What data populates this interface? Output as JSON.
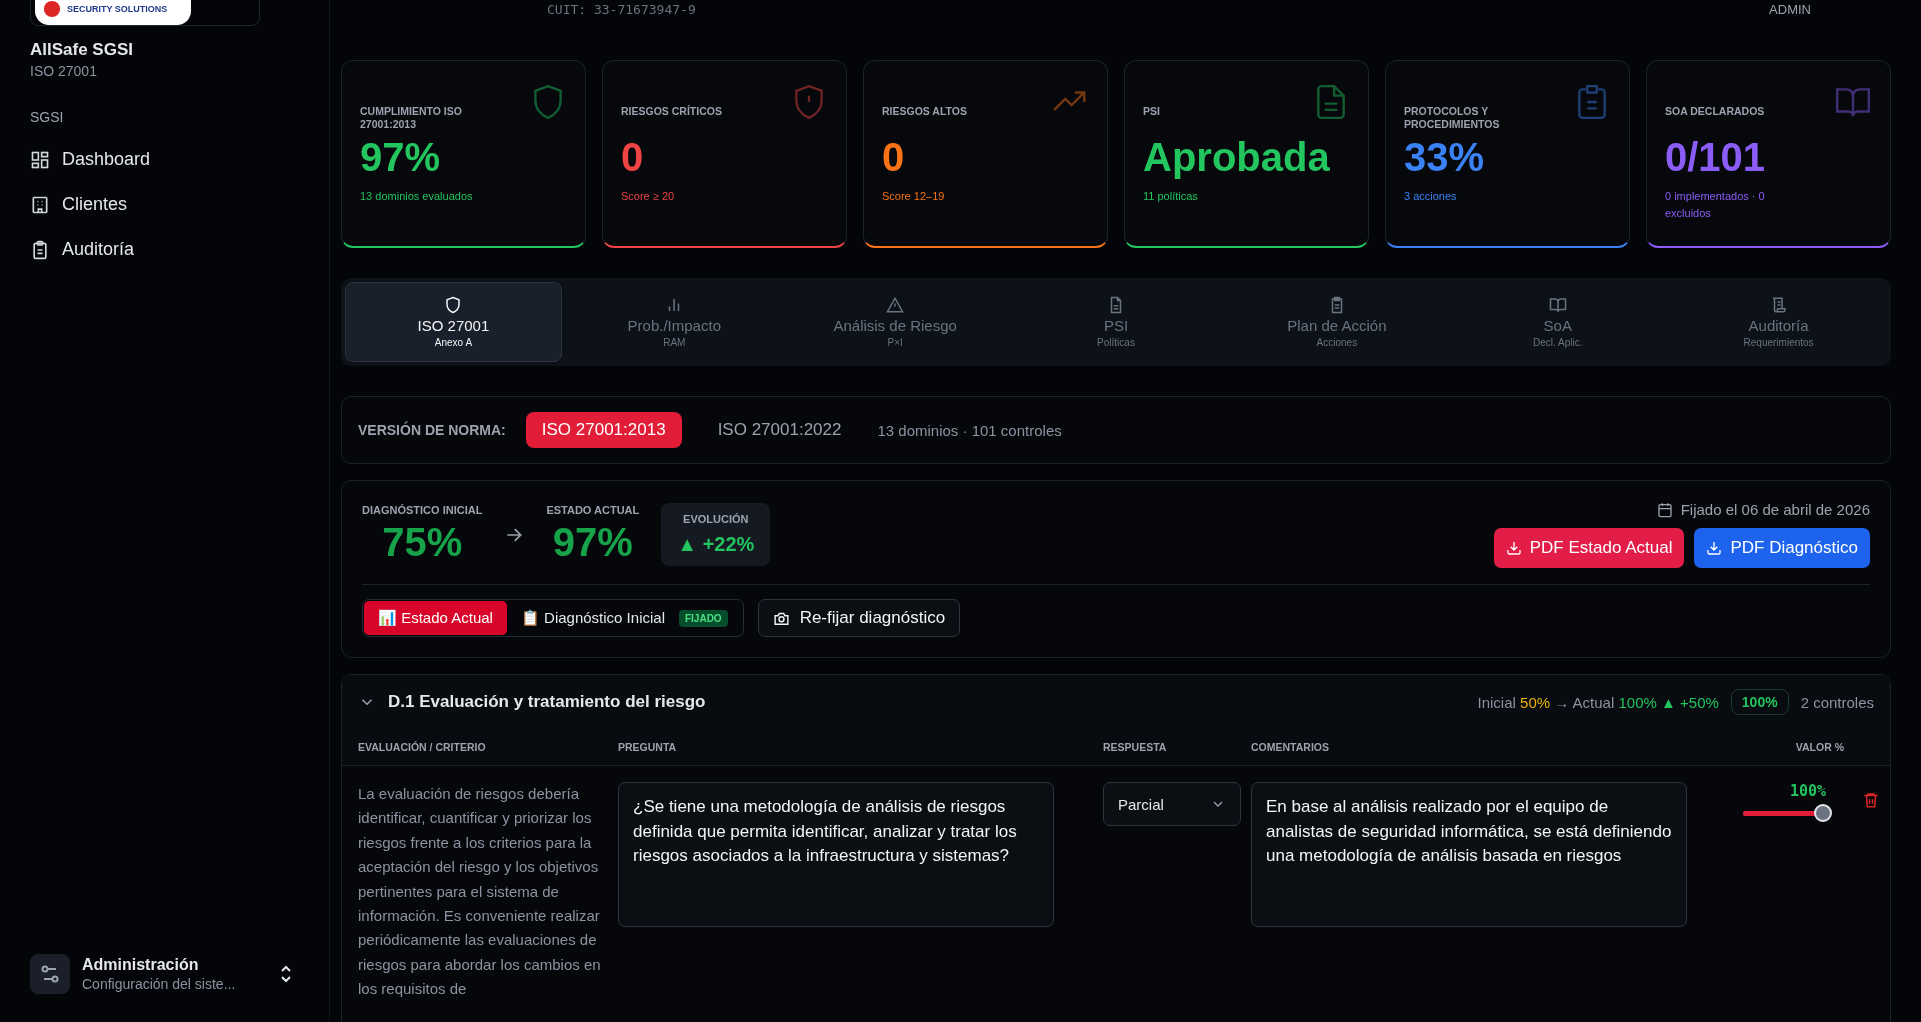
{
  "sidebar": {
    "logo_text": "SECURITY SOLUTIONS",
    "app_name": "AllSafe SGSI",
    "app_subtitle": "ISO 27001",
    "section_label": "SGSI",
    "items": [
      {
        "label": "Dashboard",
        "kind": "grid"
      },
      {
        "label": "Clientes",
        "kind": "building"
      },
      {
        "label": "Auditoría",
        "kind": "clipboard"
      }
    ],
    "footer": {
      "title": "Administración",
      "subtitle": "Configuración del siste..."
    }
  },
  "header": {
    "cuit": "CUIT: 33-71673947-9",
    "role": "ADMIN"
  },
  "stats": [
    {
      "label": "CUMPLIMIENTO ISO 27001:2013",
      "value": "97%",
      "note": "13 dominios evaluados",
      "color": "#22c55e",
      "kind": "shield"
    },
    {
      "label": "RIESGOS CRÍTICOS",
      "value": "0",
      "note": "Score ≥ 20",
      "color": "#ef4444",
      "kind": "alert"
    },
    {
      "label": "RIESGOS ALTOS",
      "value": "0",
      "note": "Score 12–19",
      "color": "#f97316",
      "kind": "trend"
    },
    {
      "label": "PSI",
      "value": "Aprobada",
      "note": "11 políticas",
      "color": "#22c55e",
      "kind": "file"
    },
    {
      "label": "PROTOCOLOS Y PROCEDIMIENTOS",
      "value": "33%",
      "note": "3 acciones",
      "color": "#3b82f6",
      "kind": "clipboard"
    },
    {
      "label": "SOA DECLARADOS",
      "value": "0/101",
      "note": "0 implementados · 0 excluidos",
      "color": "#8b5cf6",
      "kind": "book"
    }
  ],
  "tabs": [
    {
      "label": "ISO 27001",
      "sub": "Anexo A",
      "kind": "shield",
      "selected": true
    },
    {
      "label": "Prob./Impacto",
      "sub": "RAM",
      "kind": "bars",
      "selected": false
    },
    {
      "label": "Análisis de Riesgo",
      "sub": "P×I",
      "kind": "alert",
      "selected": false
    },
    {
      "label": "PSI",
      "sub": "Políticas",
      "kind": "file",
      "selected": false
    },
    {
      "label": "Plan de Acción",
      "sub": "Acciones",
      "kind": "clipboard",
      "selected": false
    },
    {
      "label": "SoA",
      "sub": "Decl. Aplic.",
      "kind": "book",
      "selected": false
    },
    {
      "label": "Auditoría",
      "sub": "Requerimientos",
      "kind": "scroll",
      "selected": false
    }
  ],
  "norm": {
    "label": "VERSIÓN DE NORMA:",
    "versions": [
      {
        "label": "ISO 27001:2013",
        "selected": true
      },
      {
        "label": "ISO 27001:2022",
        "selected": false
      }
    ],
    "summary": "13 dominios · 101 controles"
  },
  "diagnostic": {
    "initial_label": "DIAGNÓSTICO INICIAL",
    "initial_value": "75%",
    "current_label": "ESTADO ACTUAL",
    "current_value": "97%",
    "evolution_label": "EVOLUCIÓN",
    "evolution_value": "▲ +22%",
    "fixed_date": "Fijado el 06 de abril de 2026",
    "buttons": [
      {
        "label": "PDF Estado Actual",
        "kind": "red"
      },
      {
        "label": "PDF Diagnóstico",
        "kind": "blue"
      }
    ],
    "views": [
      {
        "label": "📊 Estado Actual",
        "selected": true
      },
      {
        "label": "📋 Diagnóstico Inicial",
        "badge": "FIJADO",
        "selected": false
      }
    ],
    "refix_button": "Re-fijar diagnóstico"
  },
  "domain": {
    "title": "D.1 Evaluación y tratamiento del riesgo",
    "expanded": true,
    "initial_label": "Inicial",
    "initial_value": "50%",
    "arrow": "→",
    "actual_label": "Actual",
    "actual_value": "100%",
    "delta": "▲ +50%",
    "score": "100%",
    "controls": "2 controles",
    "columns": [
      "EVALUACIÓN / CRITERIO",
      "PREGUNTA",
      "RESPUESTA",
      "COMENTARIOS",
      "VALOR %"
    ],
    "rows": [
      {
        "criterion": "La evaluación de riesgos debería identificar, cuantificar y priorizar los riesgos frente a los criterios para la aceptación del riesgo y los objetivos pertinentes para el sistema de información. Es conveniente realizar periódicamente las evaluaciones de riesgos para abordar los cambios en los requisitos de",
        "question": "¿Se tiene una metodología de análisis de riesgos definida que permita identificar, analizar y tratar los riesgos asociados a la infraestructura y sistemas?",
        "answer": "Parcial",
        "comment": "En base al análisis realizado por el equipo de analistas de seguridad informática, se está definiendo una metodología de análisis basada en riesgos",
        "value": "100%",
        "level": 1
      }
    ]
  }
}
